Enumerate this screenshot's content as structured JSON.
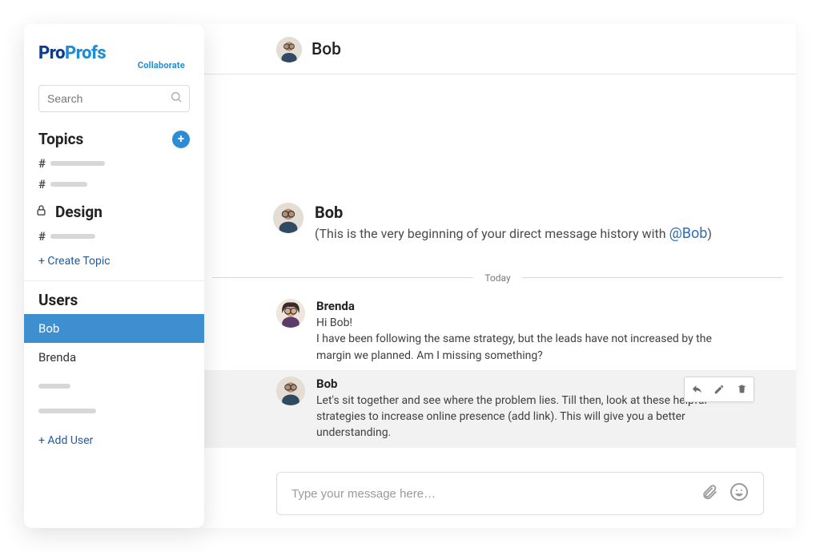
{
  "logo": {
    "top1": "Pro",
    "top2": "Profs",
    "sub": "Collaborate"
  },
  "search": {
    "placeholder": "Search"
  },
  "sidebar": {
    "topics_title": "Topics",
    "design_label": "Design",
    "create_topic": "+ Create Topic",
    "users_title": "Users",
    "users": [
      "Bob",
      "Brenda"
    ],
    "add_user": "+ Add User"
  },
  "chat": {
    "header_name": "Bob",
    "intro": {
      "name": "Bob",
      "prefix": "(This is the very beginning of your direct message history with ",
      "mention": "@Bob",
      "suffix": ")"
    },
    "date_separator": "Today",
    "messages": [
      {
        "author": "Brenda",
        "lines": [
          "Hi Bob!",
          "I have been following the same strategy, but the leads have not increased by the margin we planned. Am I missing something?"
        ]
      },
      {
        "author": "Bob",
        "lines": [
          "Let's sit together and see where the problem lies. Till then, look at these helpful strategies to increase online presence (add link). This will give you a better understanding."
        ]
      }
    ],
    "composer_placeholder": "Type your message here…"
  }
}
